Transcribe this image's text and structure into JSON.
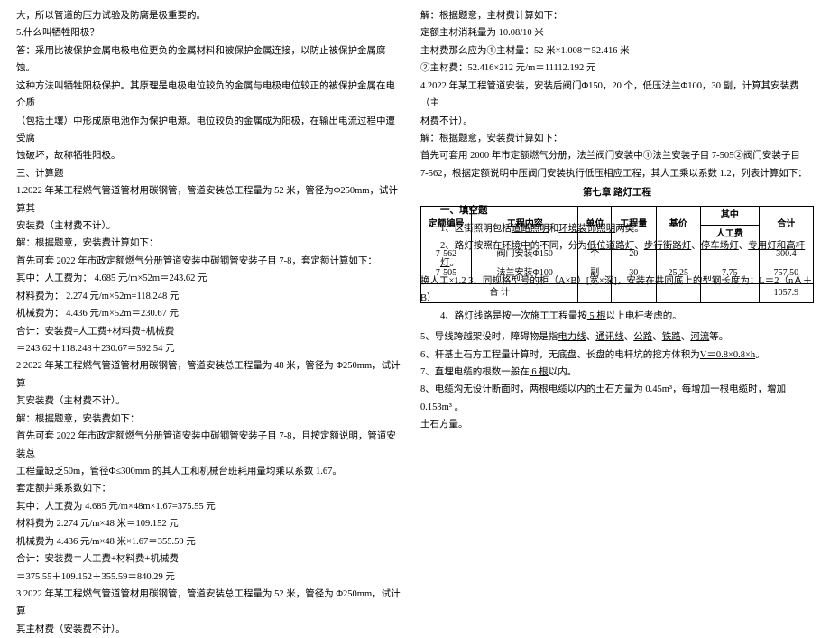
{
  "left": {
    "p1": "大，所以管道的压力试验及防腐是极重要的。",
    "p2": "5.什么叫牺牲阳极？",
    "p3_a": "答：采用比被保护金属电极电位更负的金属材料和被保护金属连接，以防止被保护金属腐蚀。",
    "p3_b": "这种方法叫牺牲阳极保护。其原理是电极电位较负的金属与电极电位较正的被保护金属在电介质",
    "p3_c": "（包括土壤）中形成原电池作为保护电源。电位较负的金属成为阳极，在输出电流过程中遭受腐",
    "p3_d": "蚀破坏，故称牺牲阳极。",
    "p4": "三、计算题",
    "p5_a": "1.2022 年某工程燃气管道管材用碳钢管，管道安装总工程量为 52 米，管径为Φ250mm，试计算其",
    "p5_b": "安装费（主材费不计）。",
    "p6": "解：根据题意，安装费计算如下：",
    "p7": "首先可套 2022 年市政定额燃气分册管道安装中碳钢管安装子目 7-8，套定额计算如下：",
    "p8": "其中：人工费为：  4.685 元/m×52m＝243.62 元",
    "p9": "      材料费为：  2.274 元/m×52m=118.248 元",
    "p10": "      机械费为：  4.436 元/m×52m＝230.67 元",
    "p11": "合计：安装费=人工费+材料费+机械费",
    "p12": "      ＝243.62＋118.248＋230.67＝592.54 元",
    "p13_a": "2  2022 年某工程燃气管道管材用碳钢管，管道安装总工程量为 48 米，管径为 Φ250mm，试计算",
    "p13_b": "其安装费（主材费不计）。",
    "p14": "解：根据题意，安装费如下：",
    "p15_a": "首先可套 2022 年市政定额燃气分册管道安装中碳钢管安装子目 7-8，且按定额说明，管道安装总",
    "p15_b": "工程量缺乏50m，管径Φ≤300mm 的其人工和机械台班耗用量均乘以系数 1.67。",
    "p16": "套定额并乘系数如下：",
    "p17": "其中：人工费为 4.685 元/m×48m×1.67=375.55 元",
    "p18": "      材料费为 2.274 元/m×48 米＝109.152 元",
    "p19": "      机械费为 4.436 元/m×48 米×1.67＝355.59 元",
    "p20": "合计：安装费＝人工费+材料费+机械费",
    "p21": "      ＝375.55＋109.152＋355.59＝840.29 元",
    "p22_a": "3  2022 年某工程燃气管道管材用碳钢管，管道安装总工程量为 52 米，管径为 Φ250mm，试计算",
    "p22_b": "其主材费（安装费不计）。"
  },
  "right": {
    "p1": "解：根据题意，主材费计算如下：",
    "p2": "定额主材消耗量为 10.08/10 米",
    "p3": "主材费那么应为①主材量：52 米×1.008＝52.416 米",
    "p4": "        ②主材费：52.416×212 元/m＝11112.192 元",
    "p5_a": "4.2022 年某工程管道安装，安装后阀门Φ150，20 个，低压法兰Φ100，30 副，计算其安装费（主",
    "p5_b": "材费不计）。",
    "p6": "解：根据题意，安装费计算如下：",
    "p7_a": "首先可套用 2000 年市定额燃气分册，法兰阀门安装中①法兰安装子目 7-505②阀门安装子目",
    "p7_b": "7-562，根据定额说明中压阀门安装执行低压相应工程，其人工乘以系数 1.2，列表计算如下：",
    "chapter": "第七章  路灯工程",
    "fill_header": "一、填空题",
    "table": {
      "headers": [
        "定额编号",
        "工程内容",
        "单位",
        "工程量",
        "基价",
        "其中\n人工费",
        "合计"
      ],
      "overlay1_pre": "1、区街照明包括",
      "overlay1_u1": "道路照明",
      "overlay1_mid": "和",
      "overlay1_u2": "环境装饰照明",
      "overlay1_post": "两类。",
      "row1": [
        "7-562",
        "阀门安装Φ150",
        "个",
        "20",
        "",
        "",
        "300.4"
      ],
      "overlay2_pre": "2、路灯按照在环境中的不同，分为",
      "overlay2_u1": "低位道路灯",
      "overlay2_c1": "、",
      "overlay2_u2": "步行街路灯",
      "overlay2_c2": "、",
      "overlay2_u3": "停车场灯",
      "overlay2_c3": "、",
      "overlay2_u4": "专用灯和高杆灯",
      "overlay2_post": "。",
      "overlay3_pre": "换人工×1.2",
      "overlay3_mid": "3、同规格型号的柜（A×B）[宽×深]，安装在共同底上的型钢长度为：L＝2（nＡ＋",
      "row2": [
        "7-505",
        "法兰安装Φ100",
        "副",
        "30",
        "25.25",
        "7.75",
        "757.50"
      ],
      "rowB": "B）",
      "sum_label": "合 计",
      "sum_val": "1057.9",
      "overlay4_pre": "4、路灯线路是按一次施工工程量按",
      "overlay4_u": " 5 根",
      "overlay4_post": "以上电杆考虑的。"
    },
    "p8_pre": "    5、导线跨越架设时，障碍物是指",
    "p8_u1": "电力线",
    "p8_c1": "、",
    "p8_u2": "通讯线",
    "p8_c2": "、",
    "p8_u3": "公路",
    "p8_c3": "、",
    "p8_u4": "铁路",
    "p8_c4": "、",
    "p8_u5": "河流",
    "p8_post": "等。",
    "p9_pre": "    6、杆基土石方工程量计算时，无底盘、长盘的电杆坑的挖方体积为",
    "p9_u": "V＝0.8×0.8×h",
    "p9_post": "。",
    "p10_pre": "    7、直埋电缆的根数一般在",
    "p10_u": " 6 根",
    "p10_post": "以内。",
    "p11_pre": "    8、电缆沟无设计断面时，两根电缆以内的土石方量为",
    "p11_u1": " 0.45m³",
    "p11_mid": "，每增加一根电缆时，增加",
    "p11_u2": " 0.153m³ ",
    "p11_post": "。",
    "p12": "土石方量。"
  }
}
